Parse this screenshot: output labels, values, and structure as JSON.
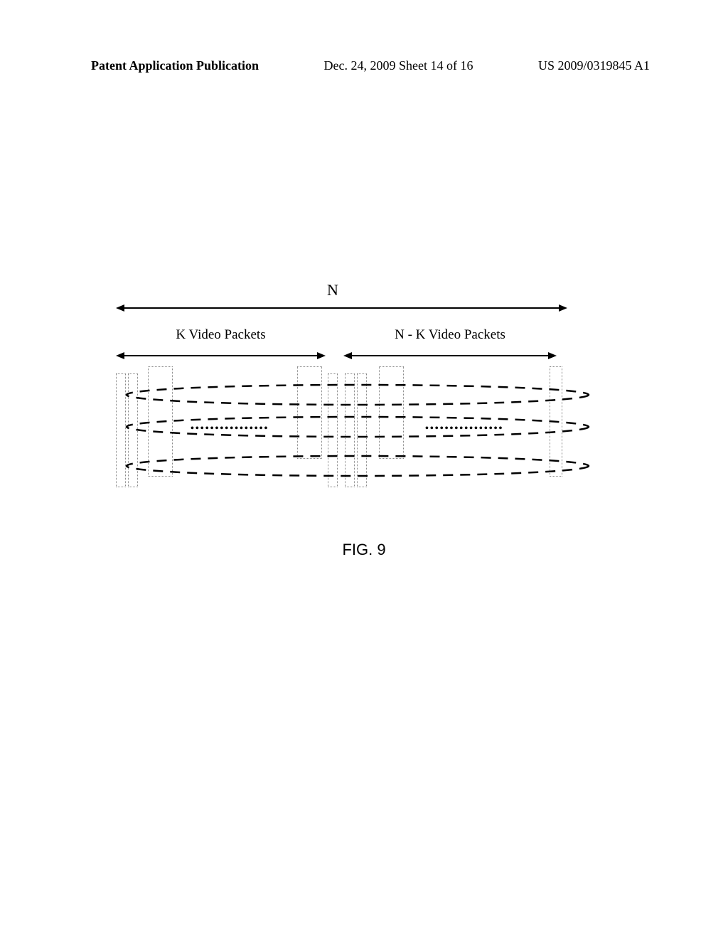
{
  "header": {
    "left": "Patent Application Publication",
    "center": "Dec. 24, 2009  Sheet 14 of 16",
    "right": "US 2009/0319845 A1"
  },
  "diagram": {
    "n_label": "N",
    "k_label": "K Video Packets",
    "nk_label": "N - K Video Packets"
  },
  "figure_label": "FIG. 9"
}
